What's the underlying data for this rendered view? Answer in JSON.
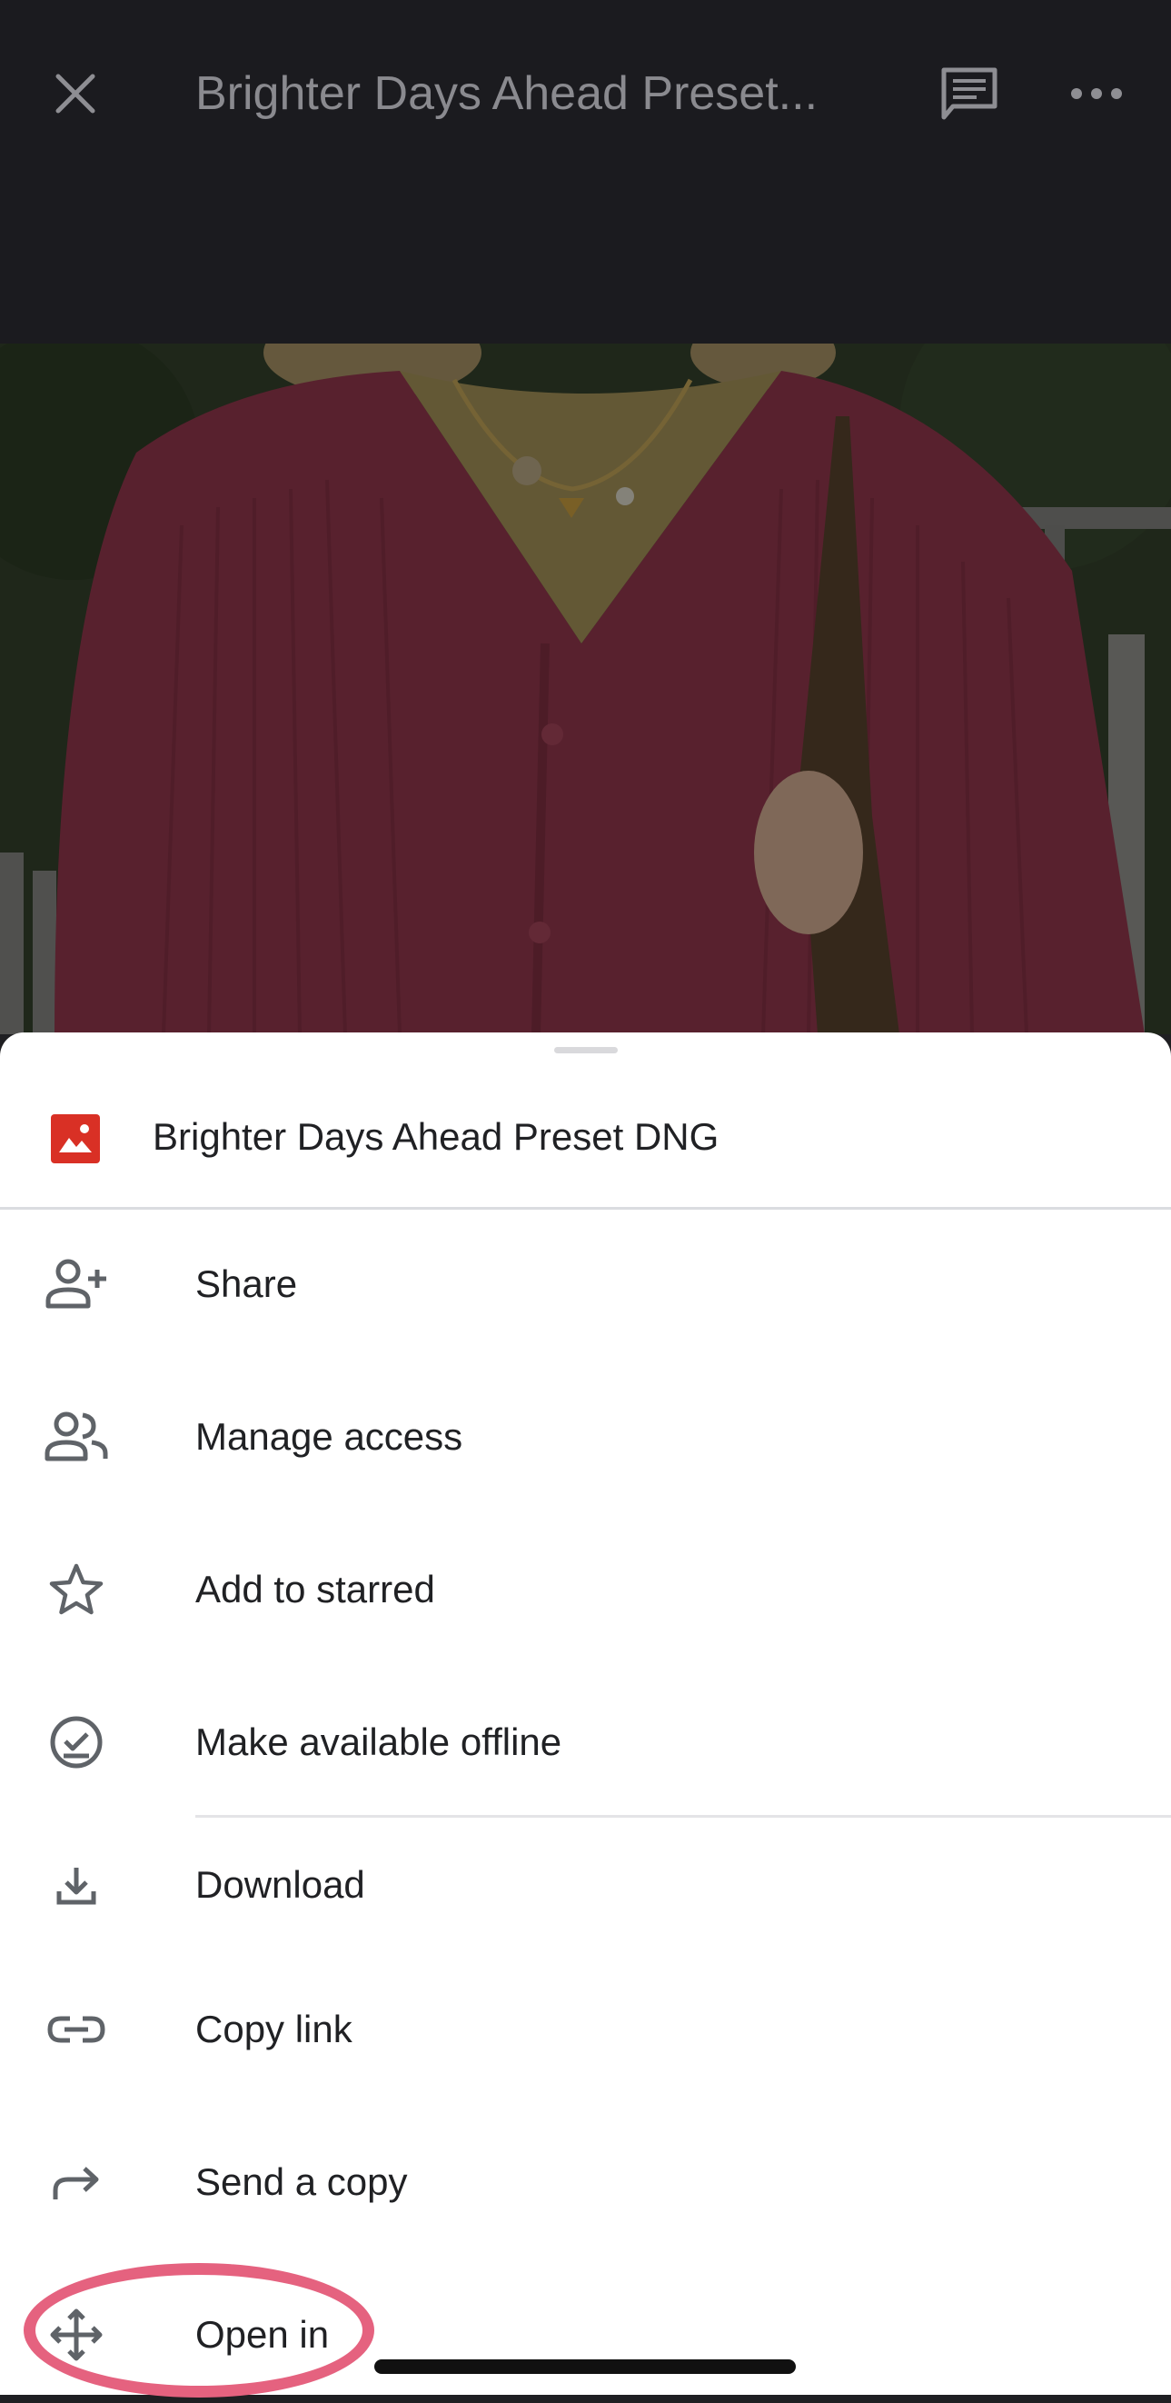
{
  "header": {
    "title": "Brighter Days Ahead Preset..."
  },
  "sheet": {
    "file_name": "Brighter Days Ahead Preset DNG",
    "items": [
      {
        "label": "Share",
        "icon": "person-add-icon"
      },
      {
        "label": "Manage access",
        "icon": "people-icon"
      },
      {
        "label": "Add to starred",
        "icon": "star-icon"
      },
      {
        "label": "Make available offline",
        "icon": "offline-check-icon"
      },
      {
        "label": "Download",
        "icon": "download-icon"
      },
      {
        "label": "Copy link",
        "icon": "link-icon"
      },
      {
        "label": "Send a copy",
        "icon": "forward-icon"
      },
      {
        "label": "Open in",
        "icon": "move-arrows-icon"
      }
    ]
  },
  "colors": {
    "file_icon": "#d93025",
    "highlight_ring": "#e5627f",
    "icon_gray": "#5f6368"
  }
}
